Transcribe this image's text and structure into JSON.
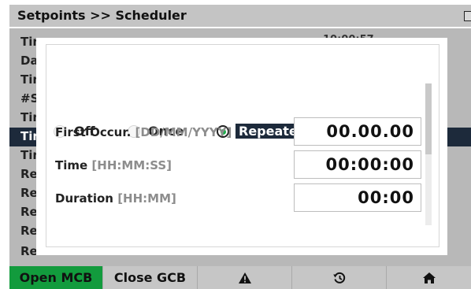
{
  "header": {
    "title": "Setpoints >> Scheduler"
  },
  "background_list": {
    "rows": [
      "Tin",
      "Da",
      "Tin",
      "#Su",
      "Tin",
      "Tin",
      "Tin",
      "Re",
      "Re",
      "Re",
      "Re",
      "Re"
    ],
    "selected_index": 5,
    "partial_value": "10:00:57"
  },
  "dialog": {
    "mode_options": [
      {
        "label": "Off",
        "selected": false
      },
      {
        "label": "Once",
        "selected": false
      },
      {
        "label": "Repeated",
        "selected": true
      }
    ],
    "fields": [
      {
        "label": "First Occur.",
        "unit": "[DD/MM/YYYY]",
        "value": "00.00.00"
      },
      {
        "label": "Time",
        "unit": "[HH:MM:SS]",
        "value": "00:00:00"
      },
      {
        "label": "Duration",
        "unit": "[HH:MM]",
        "value": "00:00"
      }
    ]
  },
  "toolbar": {
    "open_mcb": "Open MCB",
    "close_gcb": "Close GCB",
    "icons": [
      "warning-icon",
      "history-icon",
      "home-icon"
    ]
  },
  "colors": {
    "accent_green": "#129b3d",
    "radio_green": "#1bb04a",
    "selection_navy": "#1d2a3b"
  }
}
